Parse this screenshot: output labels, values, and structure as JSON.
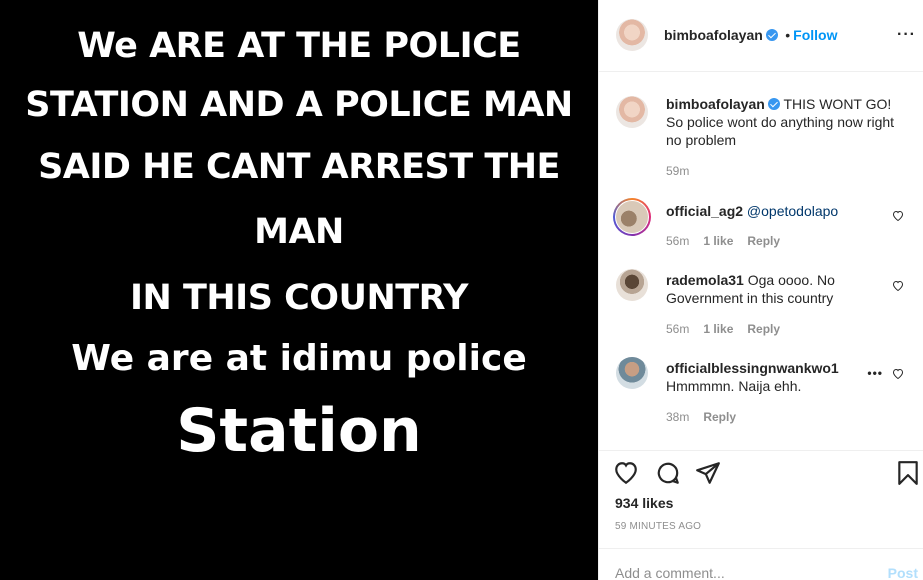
{
  "image_text": {
    "line1": "We ARE AT THE POLICE",
    "line2": "STATION AND A POLICE MAN",
    "line3": "SAID HE CANT ARREST THE",
    "line4": "MAN",
    "line5": "IN THIS COUNTRY",
    "line6": "We are at idimu police",
    "line7": "Station"
  },
  "header": {
    "username": "bimboafolayan",
    "separator": "•",
    "follow_label": "Follow",
    "more_icon": "more-dots-icon"
  },
  "caption": {
    "username": "bimboafolayan",
    "text": "THIS WONT GO! So police wont do anything now right no problem",
    "time": "59m"
  },
  "comments": [
    {
      "username": "official_ag2",
      "mention": "@opetodolapo",
      "text": "",
      "time": "56m",
      "likes": "1 like",
      "reply": "Reply"
    },
    {
      "username": "rademola31",
      "text": "Oga oooo. No Government in this country",
      "time": "56m",
      "likes": "1 like",
      "reply": "Reply"
    },
    {
      "username": "officialblessingnwankwo1",
      "text": "Hmmmmn. Naija ehh.",
      "time": "38m",
      "reply": "Reply",
      "more": "•••"
    }
  ],
  "actions": {
    "icons": [
      "heart-icon",
      "comment-icon",
      "share-icon",
      "bookmark-icon"
    ],
    "likes": "934 likes",
    "time_ago": "59 MINUTES AGO"
  },
  "add_comment": {
    "placeholder": "Add a comment...",
    "post_label": "Post",
    "post_color": "#b2dffc"
  },
  "colors": {
    "link": "#0095f6",
    "verified": "#3897f0",
    "muted": "#8e8e8e",
    "media_bg": "#000000"
  }
}
